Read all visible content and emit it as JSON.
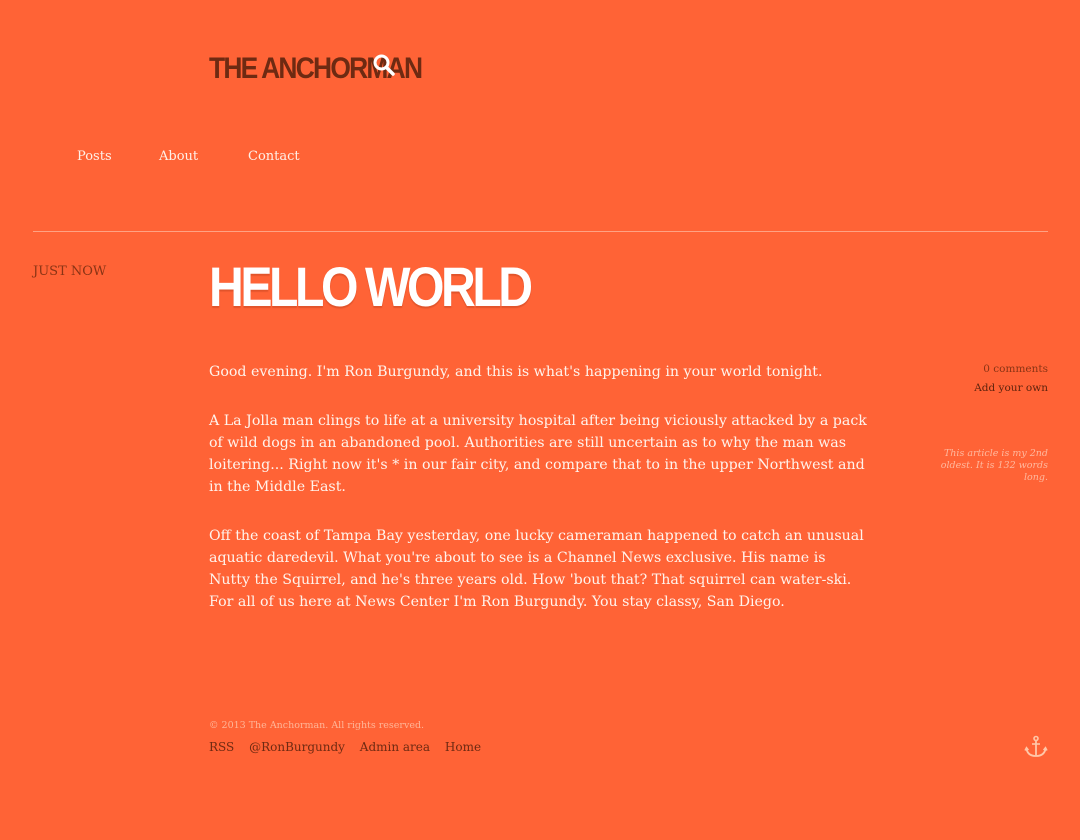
{
  "site": {
    "title": "THE ANCHORMAN",
    "search_icon": "search-icon"
  },
  "nav": {
    "items": [
      {
        "label": "Posts"
      },
      {
        "label": "About"
      },
      {
        "label": "Contact"
      }
    ]
  },
  "post": {
    "date": "Just now",
    "title": "HELLO WORLD",
    "paragraphs": [
      "Good evening. I'm Ron Burgundy, and this is what's happening in your world tonight.",
      "A La Jolla man clings to life at a university hospital after being viciously attacked by a pack of wild dogs in an abandoned pool. Authorities are still uncertain as to why the man was loitering... Right now it's * in our fair city, and compare that to in the upper Northwest and in the Middle East.",
      "Off the coast of Tampa Bay yesterday, one lucky cameraman happened to catch an unusual aquatic daredevil. What you're about to see is a Channel News exclusive. His name is Nutty the Squirrel, and he's three years old. How 'bout that? That squirrel can water-ski. For all of us here at News Center I'm Ron Burgundy. You stay classy, San Diego."
    ],
    "comments_count": "0 comments",
    "add_comment_label": "Add your own",
    "article_note": "This article is my 2nd oldest. It is 132 words long."
  },
  "footer": {
    "copyright": "© 2013 The Anchorman. All rights reserved.",
    "links": [
      {
        "label": "RSS"
      },
      {
        "label": "@RonBurgundy"
      },
      {
        "label": "Admin area"
      },
      {
        "label": "Home"
      }
    ],
    "anchor_icon": "anchor-icon"
  },
  "colors": {
    "background": "#ff6336",
    "dark_text": "#6e2a12",
    "title_white": "#ffffff"
  }
}
